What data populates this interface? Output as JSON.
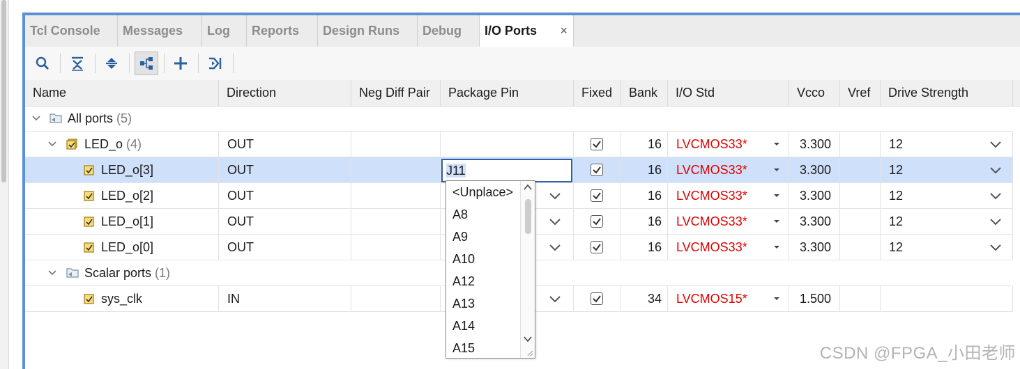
{
  "tabs": [
    {
      "label": "Tcl Console"
    },
    {
      "label": "Messages"
    },
    {
      "label": "Log"
    },
    {
      "label": "Reports"
    },
    {
      "label": "Design Runs"
    },
    {
      "label": "Debug"
    },
    {
      "label": "I/O Ports",
      "active": true,
      "close": "×"
    }
  ],
  "toolbar": {
    "icons": [
      "search-icon",
      "collapse-all-icon",
      "expand-all-icon",
      "group-by-interface-icon",
      "add-icon",
      "auto-place-icon"
    ]
  },
  "columns": [
    "Name",
    "Direction",
    "Neg Diff Pair",
    "Package Pin",
    "Fixed",
    "Bank",
    "I/O Std",
    "Vcco",
    "Vref",
    "Drive Strength"
  ],
  "groups": {
    "all_ports": {
      "label": "All ports",
      "count": "(5)"
    },
    "led_bus": {
      "label": "LED_o",
      "count": "(4)",
      "direction": "OUT",
      "bank": "16",
      "io_std": "LVCMOS33*",
      "vcco": "3.300",
      "drive": "12"
    },
    "scalar_ports": {
      "label": "Scalar ports",
      "count": "(1)"
    }
  },
  "rows": [
    {
      "name": "LED_o[3]",
      "direction": "OUT",
      "package_pin": "J11",
      "fixed": true,
      "bank": "16",
      "io_std": "LVCMOS33*",
      "vcco": "3.300",
      "drive": "12"
    },
    {
      "name": "LED_o[2]",
      "direction": "OUT",
      "package_pin": "",
      "fixed": true,
      "bank": "16",
      "io_std": "LVCMOS33*",
      "vcco": "3.300",
      "drive": "12"
    },
    {
      "name": "LED_o[1]",
      "direction": "OUT",
      "package_pin": "",
      "fixed": true,
      "bank": "16",
      "io_std": "LVCMOS33*",
      "vcco": "3.300",
      "drive": "12"
    },
    {
      "name": "LED_o[0]",
      "direction": "OUT",
      "package_pin": "",
      "fixed": true,
      "bank": "16",
      "io_std": "LVCMOS33*",
      "vcco": "3.300",
      "drive": "12"
    },
    {
      "name": "sys_clk",
      "direction": "IN",
      "package_pin": "",
      "fixed": true,
      "bank": "34",
      "io_std": "LVCMOS15*",
      "vcco": "1.500",
      "drive": ""
    }
  ],
  "pin_editor": {
    "value": "J11",
    "options": [
      "<Unplace>",
      "A8",
      "A9",
      "A10",
      "A12",
      "A13",
      "A14",
      "A15"
    ]
  },
  "watermark": "CSDN @FPGA_小田老师",
  "colors": {
    "accent": "#5b8fd6",
    "selection": "#cfe0fb",
    "io_std": "#e10000"
  }
}
